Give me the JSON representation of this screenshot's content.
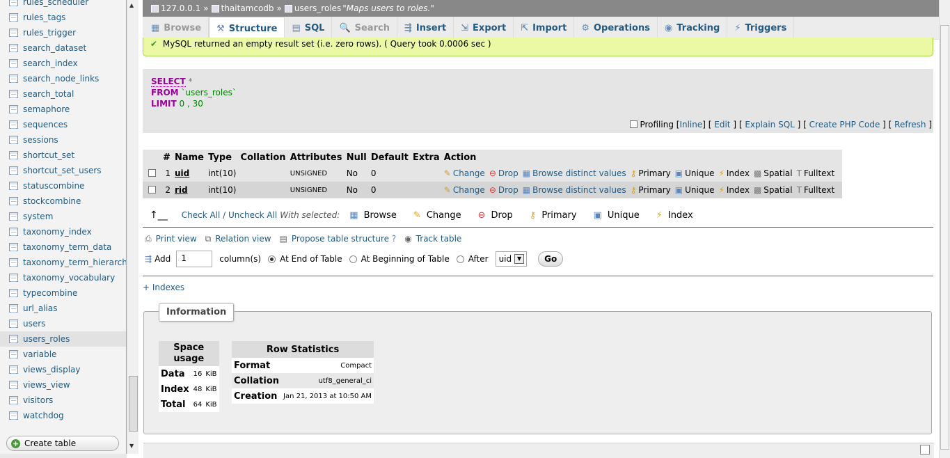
{
  "sidebar": {
    "tables": [
      "rules_scheduler",
      "rules_tags",
      "rules_trigger",
      "search_dataset",
      "search_index",
      "search_node_links",
      "search_total",
      "semaphore",
      "sequences",
      "sessions",
      "shortcut_set",
      "shortcut_set_users",
      "statuscombine",
      "stockcombine",
      "system",
      "taxonomy_index",
      "taxonomy_term_data",
      "taxonomy_term_hierarchy",
      "taxonomy_vocabulary",
      "typecombine",
      "url_alias",
      "users",
      "users_roles",
      "variable",
      "views_display",
      "views_view",
      "visitors",
      "watchdog"
    ],
    "selected": "users_roles",
    "create_table": "Create table"
  },
  "breadcrumb": {
    "server": "127.0.0.1",
    "sep": "»",
    "database": "thaitamcodb",
    "table": "users_roles",
    "comment": "\"Maps users to roles.\""
  },
  "tabs": [
    {
      "label": "Browse",
      "icon": "▦",
      "state": "disabled"
    },
    {
      "label": "Structure",
      "icon": "⚒",
      "state": "active"
    },
    {
      "label": "SQL",
      "icon": "▤",
      "state": "normal"
    },
    {
      "label": "Search",
      "icon": "🔍",
      "state": "disabled"
    },
    {
      "label": "Insert",
      "icon": "⇶",
      "state": "normal"
    },
    {
      "label": "Export",
      "icon": "⇲",
      "state": "normal"
    },
    {
      "label": "Import",
      "icon": "⇱",
      "state": "normal"
    },
    {
      "label": "Operations",
      "icon": "⚙",
      "state": "normal"
    },
    {
      "label": "Tracking",
      "icon": "◉",
      "state": "normal"
    },
    {
      "label": "Triggers",
      "icon": "⚡",
      "state": "normal"
    }
  ],
  "message": "MySQL returned an empty result set (i.e. zero rows). ( Query took 0.0006 sec )",
  "sql": {
    "select_kw": "SELECT",
    "star": "*",
    "from_kw": "FROM",
    "table": "`users_roles`",
    "limit_kw": "LIMIT",
    "limit_vals": "0 , 30",
    "profiling": "Profiling",
    "links": [
      "Inline",
      "Edit",
      "Explain SQL",
      "Create PHP Code",
      "Refresh"
    ]
  },
  "structure": {
    "headers": [
      "",
      "#",
      "Name",
      "Type",
      "Collation",
      "Attributes",
      "Null",
      "Default",
      "Extra",
      "Action"
    ],
    "rows": [
      {
        "num": "1",
        "name": "uid",
        "type": "int(10)",
        "collation": "",
        "attributes": "UNSIGNED",
        "null": "No",
        "default": "0",
        "extra": ""
      },
      {
        "num": "2",
        "name": "rid",
        "type": "int(10)",
        "collation": "",
        "attributes": "UNSIGNED",
        "null": "No",
        "default": "0",
        "extra": ""
      }
    ],
    "actions": [
      "Change",
      "Drop",
      "Browse distinct values",
      "Primary",
      "Unique",
      "Index",
      "Spatial",
      "Fulltext"
    ]
  },
  "with_selected": {
    "check_all": "Check All / Uncheck All",
    "label": "With selected:",
    "buttons": [
      "Browse",
      "Change",
      "Drop",
      "Primary",
      "Unique",
      "Index"
    ]
  },
  "tools": [
    "Print view",
    "Relation view",
    "Propose table structure",
    "Track table"
  ],
  "add_columns": {
    "add": "Add",
    "count": "1",
    "columns_label": "column(s)",
    "at_end": "At End of Table",
    "at_beginning": "At Beginning of Table",
    "after": "After",
    "after_field": "uid",
    "go": "Go"
  },
  "indexes_link": "+ Indexes",
  "information": {
    "legend": "Information",
    "space": {
      "header": "Space usage",
      "rows": [
        {
          "label": "Data",
          "value": "16",
          "unit": "KiB"
        },
        {
          "label": "Index",
          "value": "48",
          "unit": "KiB"
        },
        {
          "label": "Total",
          "value": "64",
          "unit": "KiB"
        }
      ]
    },
    "rowstats": {
      "header": "Row Statistics",
      "rows": [
        {
          "label": "Format",
          "value": "Compact"
        },
        {
          "label": "Collation",
          "value": "utf8_general_ci"
        },
        {
          "label": "Creation",
          "value": "Jan 21, 2013 at 10:50 AM"
        }
      ]
    }
  },
  "colors": {
    "accent": "#235a81",
    "success_bg": "#ebf8a4",
    "keyword": "#990099",
    "identifier": "#008000"
  }
}
